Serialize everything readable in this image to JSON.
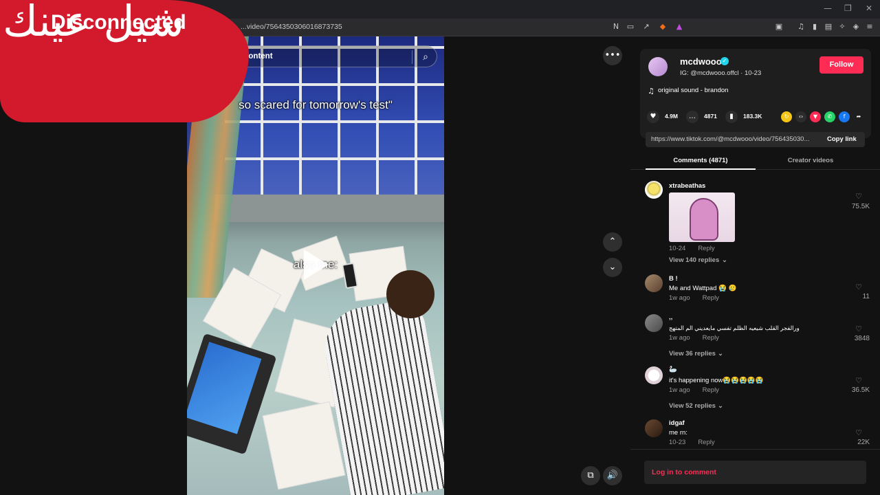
{
  "browser": {
    "url": "...video/7564350306016873735",
    "favicon": "tiktok-icon",
    "window_controls": [
      "—",
      "❐",
      "✕"
    ],
    "toolbar_icons": [
      "translate-icon",
      "cast-icon",
      "share-icon",
      "brave-shield-icon",
      "rewards-icon",
      "sidebar-icon",
      "playlist-icon",
      "reader-icon",
      "wallet-icon",
      "leo-icon",
      "vpn-icon",
      "menu-icon"
    ]
  },
  "watermark": {
    "arabic": "شيل عينك",
    "status": "Disconnected"
  },
  "video": {
    "search_placeholder": "content",
    "caption_top": "so scared for tomorrow's test\"",
    "caption_mid": "also me:"
  },
  "author": {
    "name": "mcdwooo",
    "subtitle": "IG: @mcdwooo.offcl · 10-23",
    "follow_label": "Follow",
    "music": "original sound - brandon"
  },
  "stats": {
    "likes": "4.9M",
    "comments": "4871",
    "saves": "183.3K"
  },
  "share": {
    "link": "https://www.tiktok.com/@mcdwooo/video/756435030...",
    "copy_label": "Copy link"
  },
  "tabs": [
    {
      "label": "Comments (4871)",
      "active": true
    },
    {
      "label": "Creator videos",
      "active": false
    }
  ],
  "comments": [
    {
      "user": "xtrabeathas",
      "text": "",
      "date": "10-24",
      "reply": "Reply",
      "likes": "75.5K",
      "view_replies": "View 140 replies",
      "has_image": true
    },
    {
      "user": "B !",
      "text": "Me and Wattpad 😭 🥲",
      "date": "1w ago",
      "reply": "Reply",
      "likes": "11"
    },
    {
      "user": "‚‚",
      "text": "ورالفجر القلب شيعيه الظلم تفسي مايعديني الم المتهج",
      "date": "1w ago",
      "reply": "Reply",
      "likes": "3848",
      "view_replies": "View 36 replies"
    },
    {
      "user": "🦢",
      "text": "it's happening now😭😭😭😭😭",
      "date": "1w ago",
      "reply": "Reply",
      "likes": "36.5K",
      "view_replies": "View 52 replies"
    },
    {
      "user": "idgaf",
      "text": "me rn:",
      "date": "10-23",
      "reply": "Reply",
      "likes": "22K"
    }
  ],
  "login_label": "Log in to comment",
  "colors": {
    "accent": "#fe2c55",
    "background": "#121212",
    "verified": "#20d5ec"
  }
}
